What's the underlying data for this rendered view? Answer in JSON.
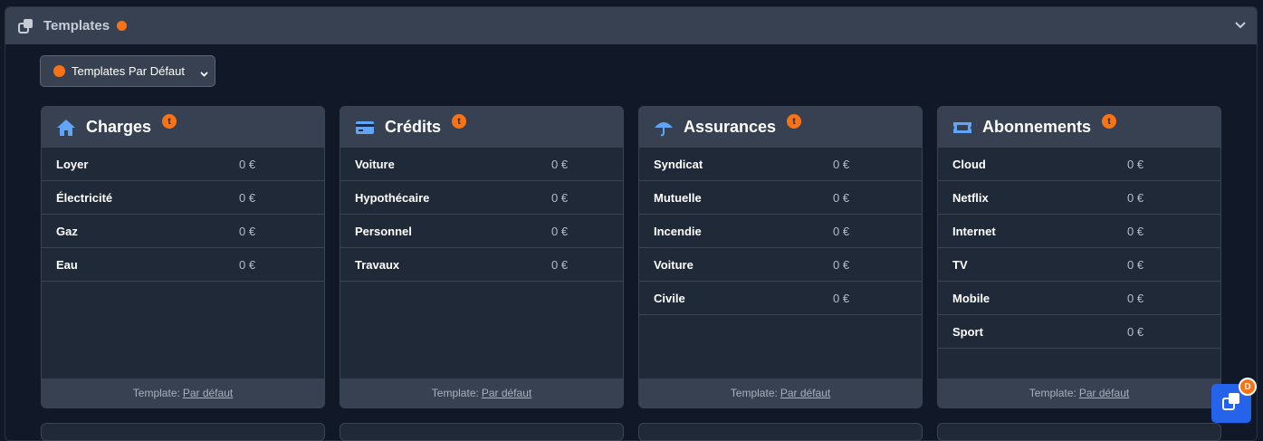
{
  "panel": {
    "title": "Templates",
    "status_color": "#f97316"
  },
  "template_select": {
    "selected": "Templates Par Défaut"
  },
  "cards": [
    {
      "title": "Charges",
      "icon": "home-icon",
      "badge": "t",
      "rows": [
        {
          "name": "Loyer",
          "value": "0 €"
        },
        {
          "name": "Électricité",
          "value": "0 €"
        },
        {
          "name": "Gaz",
          "value": "0 €"
        },
        {
          "name": "Eau",
          "value": "0 €"
        }
      ],
      "footer_label": "Template:",
      "footer_link": "Par défaut"
    },
    {
      "title": "Crédits",
      "icon": "credit-card-icon",
      "badge": "t",
      "rows": [
        {
          "name": "Voiture",
          "value": "0 €"
        },
        {
          "name": "Hypothécaire",
          "value": "0 €"
        },
        {
          "name": "Personnel",
          "value": "0 €"
        },
        {
          "name": "Travaux",
          "value": "0 €"
        }
      ],
      "footer_label": "Template:",
      "footer_link": "Par défaut"
    },
    {
      "title": "Assurances",
      "icon": "umbrella-icon",
      "badge": "t",
      "rows": [
        {
          "name": "Syndicat",
          "value": "0 €"
        },
        {
          "name": "Mutuelle",
          "value": "0 €"
        },
        {
          "name": "Incendie",
          "value": "0 €"
        },
        {
          "name": "Voiture",
          "value": "0 €"
        },
        {
          "name": "Civile",
          "value": "0 €"
        }
      ],
      "footer_label": "Template:",
      "footer_link": "Par défaut"
    },
    {
      "title": "Abonnements",
      "icon": "ticket-icon",
      "badge": "t",
      "rows": [
        {
          "name": "Cloud",
          "value": "0 €"
        },
        {
          "name": "Netflix",
          "value": "0 €"
        },
        {
          "name": "Internet",
          "value": "0 €"
        },
        {
          "name": "TV",
          "value": "0 €"
        },
        {
          "name": "Mobile",
          "value": "0 €"
        },
        {
          "name": "Sport",
          "value": "0 €"
        }
      ],
      "footer_label": "Template:",
      "footer_link": "Par défaut"
    }
  ],
  "fab": {
    "icon": "copy-icon",
    "badge": "D"
  }
}
